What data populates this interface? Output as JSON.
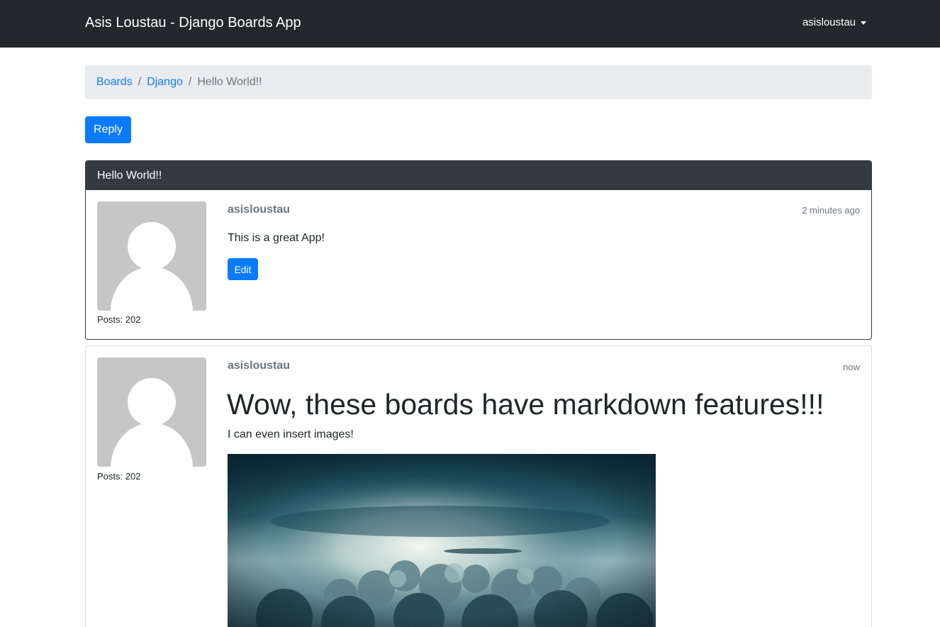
{
  "navbar": {
    "brand": "Asis Loustau - Django Boards App",
    "user_menu": "asisloustau",
    "user_menu_icon": "caret-down-icon"
  },
  "breadcrumb": {
    "items": [
      "Boards",
      "Django"
    ],
    "separator": "/",
    "active": "Hello World!!"
  },
  "actions": {
    "reply_label": "Reply"
  },
  "topic": {
    "subject": "Hello World!!"
  },
  "posts": [
    {
      "author": "asisloustau",
      "time": "2 minutes ago",
      "posts_count": "Posts: 202",
      "message": "This is a great App!",
      "edit_label": "Edit",
      "avatar_icon": "user-avatar-icon"
    },
    {
      "author": "asisloustau",
      "time": "now",
      "posts_count": "Posts: 202",
      "heading": "Wow, these boards have markdown features!!!",
      "message": "I can even insert images!",
      "image": "clouds-sky-image",
      "avatar_icon": "user-avatar-icon"
    }
  ],
  "colors": {
    "navbar": "#24272b",
    "primary": "#0a7bfd",
    "card_header": "#343a40",
    "breadcrumb_bg": "#e9ecef",
    "link": "#0d7cf5"
  }
}
